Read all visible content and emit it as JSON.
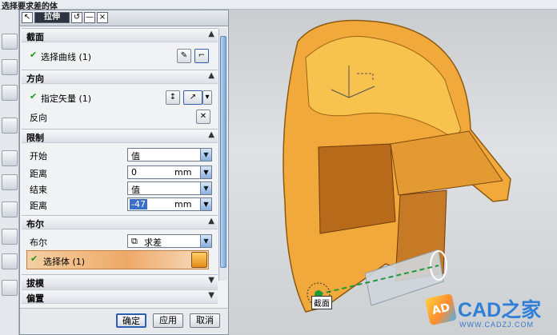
{
  "window": {
    "title": "选择要求差的体"
  },
  "toolbar": {
    "extrude_label": "拉伸",
    "min_label": "—",
    "close_label": "×"
  },
  "sections": {
    "section": {
      "label": "截面",
      "select_curve": "选择曲线 (1)"
    },
    "direction": {
      "label": "方向",
      "specify_vector": "指定矢量 (1)",
      "reverse": "反向"
    },
    "limits": {
      "label": "限制",
      "start_label": "开始",
      "start_value": "值",
      "distance_label": "距离",
      "start_distance": "0",
      "start_unit": "mm",
      "end_label": "结束",
      "end_value": "值",
      "end_distance_label": "距离",
      "end_distance": "-47",
      "end_unit": "mm"
    },
    "boolean": {
      "label": "布尔",
      "bool_label": "布尔",
      "bool_value": "求差",
      "select_body": "选择体 (1)"
    },
    "draft": {
      "label": "拔模"
    },
    "offset": {
      "label": "偏置"
    }
  },
  "buttons": {
    "ok": "确定",
    "apply": "应用",
    "cancel": "取消"
  },
  "viewport": {
    "callout": "截面"
  },
  "watermark": {
    "brand": "CAD之家",
    "url": "WWW.CADZJ.COM",
    "badge": "AD"
  },
  "colors": {
    "model_orange": "#f2a93b",
    "accent_green": "#1b9a1b",
    "selection_orange": "#eea968"
  }
}
